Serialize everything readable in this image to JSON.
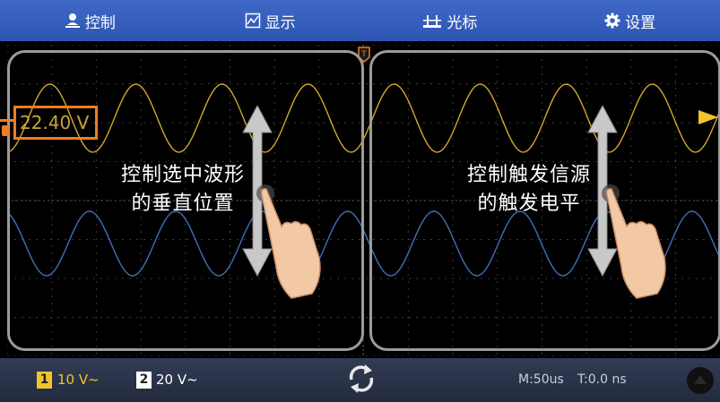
{
  "menu": {
    "control": {
      "label": "控制",
      "icon": "user-icon"
    },
    "display": {
      "label": "显示",
      "icon": "chart-icon"
    },
    "cursor": {
      "label": "光标",
      "icon": "cursor-icon"
    },
    "settings": {
      "label": "设置",
      "icon": "gear-icon"
    }
  },
  "left_panel": {
    "line1": "控制选中波形",
    "line2": "的垂直位置"
  },
  "right_panel": {
    "line1": "控制触发信源",
    "line2": "的触发电平"
  },
  "value_readout": "22.40 V",
  "trigger_marker": "T",
  "channels": [
    {
      "number": "1",
      "scale": "10 V~",
      "color": "#f2c42a"
    },
    {
      "number": "2",
      "scale": "20 V~",
      "color": "#ffffff"
    }
  ],
  "timebase": "M:50us",
  "trigger_pos": "T:0.0 ns",
  "colors": {
    "ch1": "#d1a72a",
    "ch2": "#3f70b8",
    "menu_bar": "#3560bd",
    "highlight": "#ee7d22"
  }
}
